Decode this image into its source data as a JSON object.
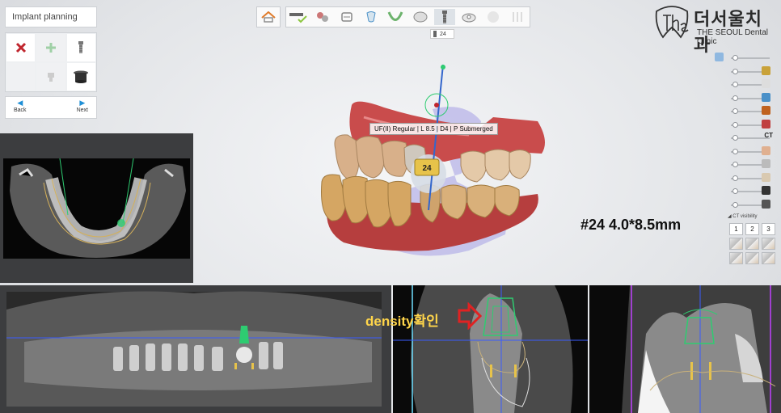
{
  "panel": {
    "title": "Implant planning",
    "tools": [
      {
        "icon": "delete-x-icon",
        "state": "enabled"
      },
      {
        "icon": "add-plus-icon",
        "state": "disabled"
      },
      {
        "icon": "implant-icon",
        "state": "enabled"
      },
      {
        "icon": "blank",
        "state": "disabled"
      },
      {
        "icon": "abutment-icon",
        "state": "disabled"
      },
      {
        "icon": "sleeve-icon",
        "state": "enabled"
      }
    ],
    "back_label": "Back",
    "next_label": "Next"
  },
  "toolbar": {
    "tooth_tag": "24",
    "items": [
      {
        "icon": "scan-check-icon",
        "state": "done"
      },
      {
        "icon": "align-icon",
        "state": "enabled"
      },
      {
        "icon": "crown-icon",
        "state": "enabled"
      },
      {
        "icon": "nerve-icon",
        "state": "enabled"
      },
      {
        "icon": "arch-icon",
        "state": "enabled"
      },
      {
        "icon": "tooth-icon",
        "state": "enabled"
      },
      {
        "icon": "implant-icon",
        "state": "active"
      },
      {
        "icon": "guide-icon",
        "state": "enabled"
      },
      {
        "icon": "sphere-icon",
        "state": "dim"
      },
      {
        "icon": "drill-icon",
        "state": "dim"
      }
    ]
  },
  "logo": {
    "mark": "the",
    "korean": "더서울치과",
    "english": "THE SEOUL Dental Clinic"
  },
  "sliders": [
    {
      "icon": "implant-layer-icon",
      "value": 0.1,
      "label": ""
    },
    {
      "icon": "crown-layer-icon",
      "value": 0.1,
      "label": ""
    },
    {
      "icon": "tooth-layer-icon",
      "value": 0.1,
      "label": ""
    },
    {
      "icon": "sleeve-layer-icon",
      "value": 0.1,
      "label": ""
    },
    {
      "icon": "drill-layer-icon",
      "value": 0.1,
      "label": ""
    },
    {
      "icon": "nerve-layer-icon",
      "value": 0.1,
      "label": ""
    },
    {
      "icon": "ct-icon",
      "value": 0.1,
      "label": "CT"
    },
    {
      "icon": "face-layer-icon",
      "value": 0.1,
      "label": ""
    },
    {
      "icon": "scan-layer-icon",
      "value": 0.1,
      "label": ""
    },
    {
      "icon": "gum-layer-icon",
      "value": 0.1,
      "label": ""
    },
    {
      "icon": "brightness-icon",
      "value": 0.1,
      "label": ""
    },
    {
      "icon": "contrast-icon",
      "value": 0.1,
      "label": ""
    }
  ],
  "ct_visibility": {
    "label": "CT visibility",
    "buttons": [
      "1",
      "2",
      "3"
    ]
  },
  "viewport": {
    "implant_info": "UF(II) Regular | L 8.5 | D4 | P Submerged",
    "tooth_number": "24",
    "spec_annotation": "#24 4.0*8.5mm"
  },
  "cross_section": {
    "annotation": "density확인"
  },
  "colors": {
    "accent_blue": "#1f8fd6",
    "delete_red": "#c0262e",
    "implant_green": "#2ecc71",
    "annotation_yellow": "#ffd54a",
    "arrow_red": "#e02222"
  }
}
